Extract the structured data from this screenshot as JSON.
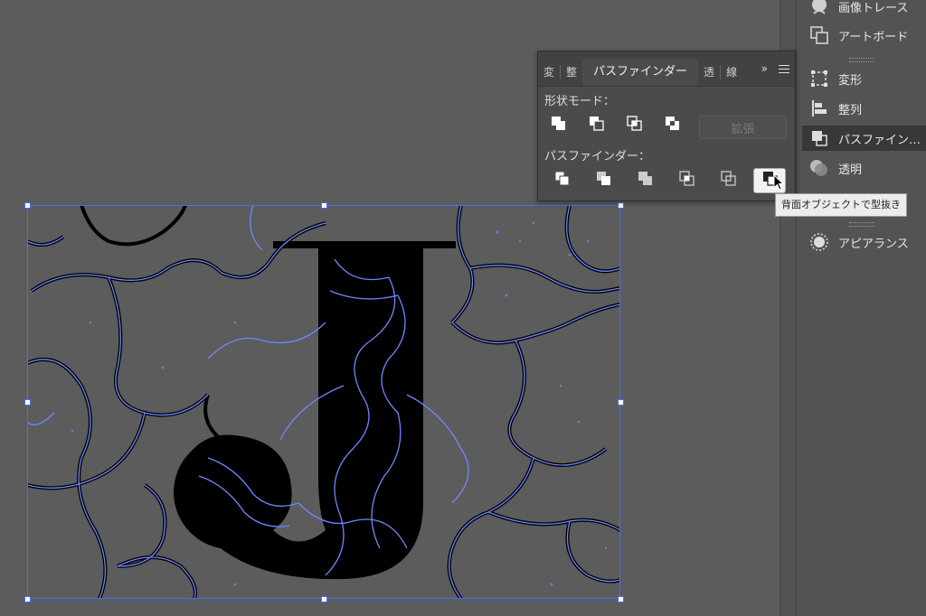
{
  "canvas": {
    "letter": "J"
  },
  "dock": {
    "items": [
      {
        "label": "画像トレース",
        "icon": "image-trace-icon"
      },
      {
        "label": "アートボード",
        "icon": "artboard-icon"
      },
      {
        "label": "変形",
        "icon": "transform-icon"
      },
      {
        "label": "整列",
        "icon": "align-icon"
      },
      {
        "label": "パスファイン…",
        "icon": "pathfinder-icon"
      },
      {
        "label": "透明",
        "icon": "transparency-icon"
      },
      {
        "label": "アピアランス",
        "icon": "appearance-icon"
      }
    ]
  },
  "pathfinder": {
    "tabs": [
      "変",
      "整",
      "パスファインダー",
      "透",
      "線"
    ],
    "more": "»",
    "shape_modes_label": "形状モード：",
    "expand_label": "拡張",
    "pathfinders_label": "パスファインダー：",
    "shape_mode_buttons": [
      "unite-icon",
      "minus-front-icon",
      "intersect-icon",
      "exclude-icon"
    ],
    "pathfinder_buttons": [
      "divide-icon",
      "trim-icon",
      "merge-icon",
      "crop-icon",
      "outline-icon",
      "minus-back-icon"
    ]
  },
  "tooltip": {
    "text": "背面オブジェクトで型抜き"
  },
  "colors": {
    "selection": "#4a6cf7",
    "canvas": "#5c5c5c",
    "panel": "#4b4b4b"
  }
}
